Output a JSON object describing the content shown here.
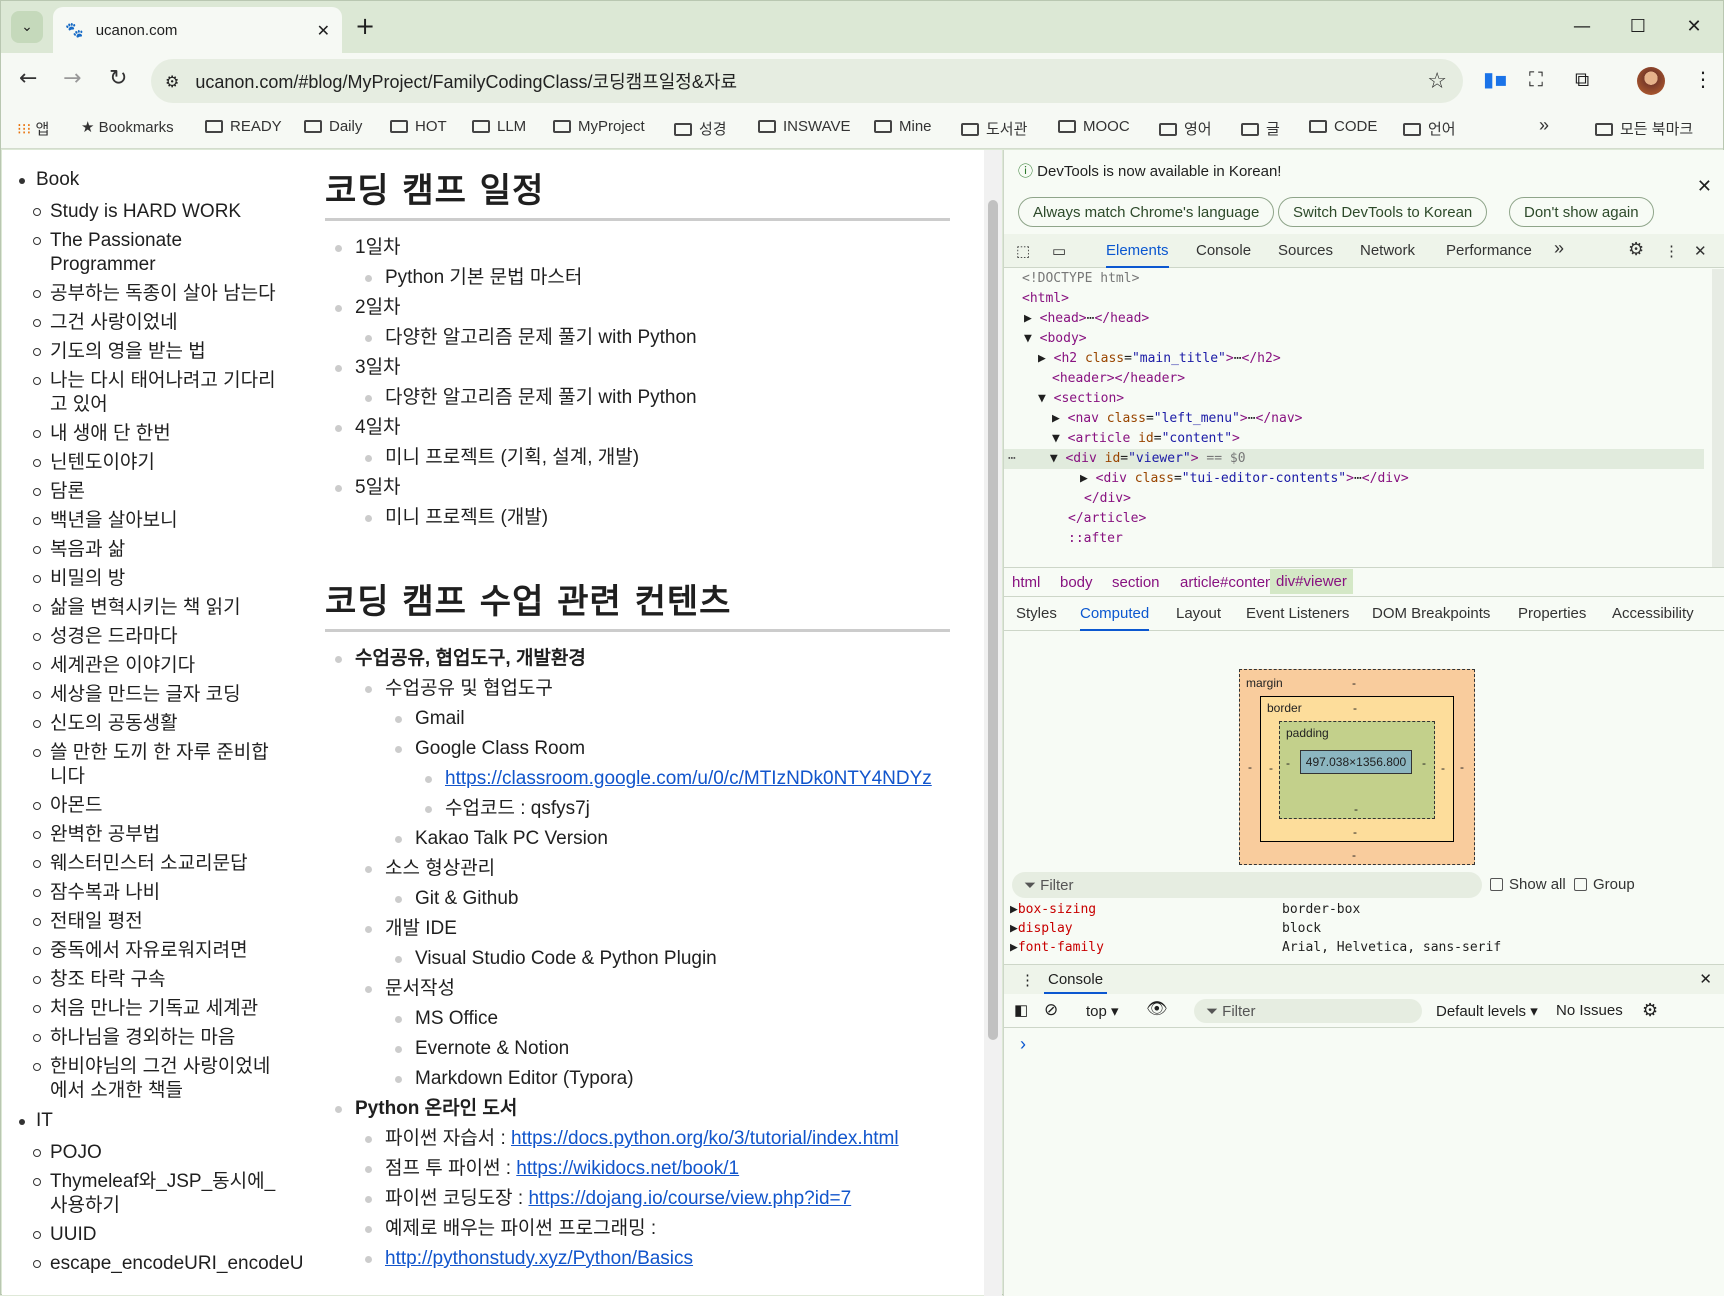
{
  "tab": {
    "title": "ucanon.com",
    "close": "✕",
    "new": "+"
  },
  "window_controls": {
    "minimize": "—",
    "maximize": "☐",
    "close": "✕"
  },
  "nav": {
    "url": "ucanon.com/#blog/MyProject/FamilyCodingClass/코딩캠프일정&자료"
  },
  "bookmarks": {
    "apps_label": "앱",
    "bookmarks_label": "Bookmarks",
    "folders": [
      "READY",
      "Daily",
      "HOT",
      "LLM",
      "MyProject",
      "성경",
      "INSWAVE",
      "Mine",
      "도서관",
      "MOOC",
      "영어",
      "글",
      "CODE",
      "언어"
    ],
    "more": "»",
    "all_label": "모든 북마크"
  },
  "sidebar": {
    "book_heading": "Book",
    "book_items": [
      "Study is HARD WORK",
      "The Passionate Programmer",
      "공부하는 독종이 살아 남는다",
      "그건 사랑이었네",
      "기도의 영을 받는 법",
      "나는 다시 태어나려고 기다리고 있어",
      "내 생애 단 한번",
      "닌텐도이야기",
      "담론",
      "백년을 살아보니",
      "복음과 삶",
      "비밀의 방",
      "삶을 변혁시키는 책 읽기",
      "성경은 드라마다",
      "세계관은 이야기다",
      "세상을 만드는 글자 코딩",
      "신도의 공동생활",
      "쓸 만한 도끼 한 자루 준비합니다",
      "아몬드",
      "완벽한 공부법",
      "웨스터민스터 소교리문답",
      "잠수복과 나비",
      "전태일 평전",
      "중독에서 자유로워지려면",
      "창조 타락 구속",
      "처음 만나는 기독교 세계관",
      "하나님을 경외하는 마음",
      "한비야님의 그건 사랑이었네에서 소개한 책들"
    ],
    "it_heading": "IT",
    "it_items": [
      "POJO",
      "Thymeleaf와_JSP_동시에_사용하기",
      "UUID",
      "escape_encodeURI_encodeU"
    ]
  },
  "content": {
    "schedule_title": "코딩 캠프 일정",
    "days": [
      {
        "day": "1일차",
        "desc": "Python 기본 문법 마스터"
      },
      {
        "day": "2일차",
        "desc": "다양한 알고리즘 문제 풀기 with Python"
      },
      {
        "day": "3일차",
        "desc": "다양한 알고리즘 문제 풀기 with Python"
      },
      {
        "day": "4일차",
        "desc": "미니 프로젝트 (기획, 설계, 개발)"
      },
      {
        "day": "5일차",
        "desc": "미니 프로젝트 (개발)"
      }
    ],
    "contents_title": "코딩 캠프 수업 관련 컨텐츠",
    "section1": "수업공유, 협업도구, 개발환경",
    "collab": "수업공유 및 협업도구",
    "gmail": "Gmail",
    "classroom": "Google Class Room",
    "classroom_link": "https://classroom.google.com/u/0/c/MTIzNDk0NTY4NDYz",
    "class_code": "수업코드 : qsfys7j",
    "kakao": "Kakao Talk PC Version",
    "source_mgmt": "소스 형상관리",
    "git": "Git & Github",
    "ide": "개발 IDE",
    "vscode": "Visual Studio Code & Python Plugin",
    "docs": "문서작성",
    "ms_office": "MS Office",
    "evernote": "Evernote & Notion",
    "markdown": "Markdown Editor (Typora)",
    "section2": "Python 온라인 도서",
    "book1_label": "파이썬 자습서 : ",
    "book1_link": "https://docs.python.org/ko/3/tutorial/index.html",
    "book2_label": "점프 투 파이썬 : ",
    "book2_link": "https://wikidocs.net/book/1",
    "book3_label": "파이썬 코딩도장 : ",
    "book3_link": "https://dojang.io/course/view.php?id=7",
    "book4_label": "예제로 배우는 파이썬 프로그래밍 :",
    "book4_link": "http://pythonstudy.xyz/Python/Basics"
  },
  "devtools": {
    "info_message": "DevTools is now available in Korean!",
    "btn_match": "Always match Chrome's language",
    "btn_switch": "Switch DevTools to Korean",
    "btn_dont": "Don't show again",
    "tabs": [
      "Elements",
      "Console",
      "Sources",
      "Network",
      "Performance"
    ],
    "more_tabs": "»",
    "dom": {
      "doctype": "<!DOCTYPE html>",
      "html": "<html>",
      "head": "<head>",
      "head_close": "</head>",
      "body": "<body>",
      "h2_open": "<h2 ",
      "h2_attr": "class",
      "h2_val": "\"main_title\"",
      "h2_close": "</h2>",
      "header": "<header></header>",
      "section": "<section>",
      "nav_open": "<nav ",
      "nav_attr": "class",
      "nav_val": "\"left_menu\"",
      "nav_close": "</nav>",
      "article_open": "<article ",
      "article_attr": "id",
      "article_val": "\"content\"",
      "div_open": "<div ",
      "div_attr": "id",
      "div_val": "\"viewer\"",
      "div_eq": " == $0",
      "inner_open": "<div ",
      "inner_attr": "class",
      "inner_val": "\"tui-editor-contents\"",
      "inner_close": "</div>",
      "div_end": "</div>",
      "article_end": "</article>",
      "after": "::after"
    },
    "breadcrumbs": [
      "html",
      "body",
      "section",
      "article#content",
      "div#viewer"
    ],
    "style_tabs": [
      "Styles",
      "Computed",
      "Layout",
      "Event Listeners",
      "DOM Breakpoints",
      "Properties",
      "Accessibility"
    ],
    "box": {
      "margin": "margin",
      "border": "border",
      "padding": "padding",
      "content": "497.038×1356.800",
      "dash": "-"
    },
    "filter_placeholder": "Filter",
    "show_all": "Show all",
    "group": "Group",
    "computed": [
      {
        "name": "box-sizing",
        "value": "border-box"
      },
      {
        "name": "display",
        "value": "block"
      },
      {
        "name": "font-family",
        "value": "Arial, Helvetica, sans-serif"
      }
    ],
    "console_tab": "Console",
    "console_context": "top",
    "console_filter": "Filter",
    "default_levels": "Default levels",
    "no_issues": "No Issues",
    "prompt": "›"
  }
}
